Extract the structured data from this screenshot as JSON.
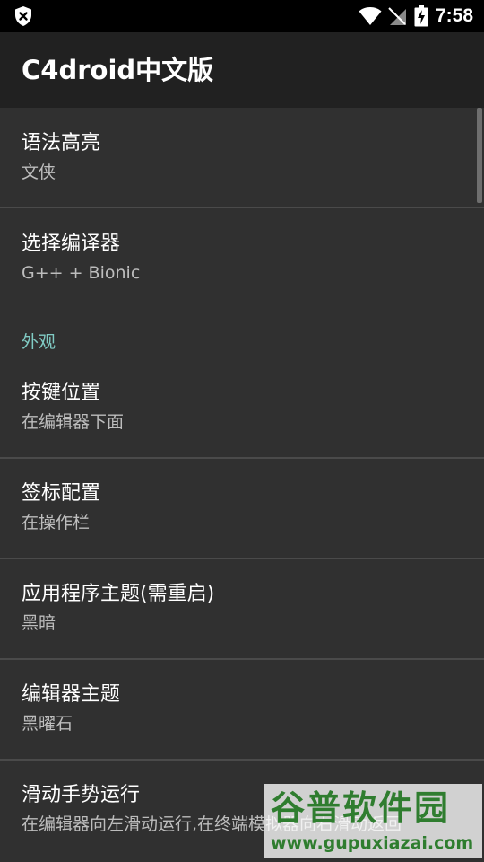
{
  "status_bar": {
    "time": "7:58",
    "left_icon": "shield-x-icon",
    "icons": [
      "wifi-icon",
      "no-sim-icon",
      "battery-charging-icon"
    ]
  },
  "app_bar": {
    "title": "C4droid中文版"
  },
  "preferences": {
    "syntax": {
      "title": "语法高亮",
      "summary": "文侠"
    },
    "compiler": {
      "title": "选择编译器",
      "summary": "G++ + Bionic"
    },
    "appearance_category": "外观",
    "key_position": {
      "title": "按键位置",
      "summary": "在编辑器下面"
    },
    "tab_config": {
      "title": "签标配置",
      "summary": "在操作栏"
    },
    "app_theme": {
      "title": "应用程序主题(需重启)",
      "summary": "黑暗"
    },
    "editor_theme": {
      "title": "编辑器主题",
      "summary": "黑曜石"
    },
    "swipe_run": {
      "title": "滑动手势运行",
      "summary": "在编辑器向左滑动运行,在终端模拟器向右滑动返回"
    }
  },
  "watermark": {
    "name": "谷普软件园",
    "url": "www.gupuxiazai.com"
  },
  "colors": {
    "status_bar_bg": "#000000",
    "app_bar_bg": "#212121",
    "list_bg": "#303030",
    "category_accent": "#80cbc4",
    "watermark_green": "#2f7d2f"
  }
}
